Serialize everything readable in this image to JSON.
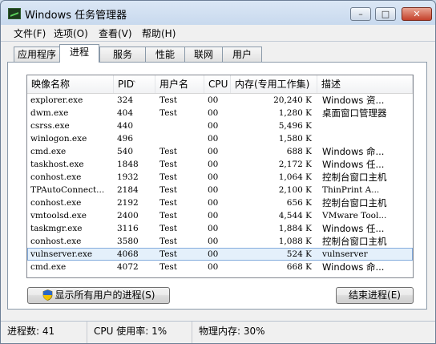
{
  "window": {
    "title": "Windows 任务管理器"
  },
  "window_buttons": {
    "minimize": "–",
    "maximize": "□",
    "close": "✕"
  },
  "menu": [
    "文件(F)",
    "选项(O)",
    "查看(V)",
    "帮助(H)"
  ],
  "tabs": [
    {
      "label": "应用程序",
      "active": false
    },
    {
      "label": "进程",
      "active": true
    },
    {
      "label": "服务",
      "active": false
    },
    {
      "label": "性能",
      "active": false
    },
    {
      "label": "联网",
      "active": false
    },
    {
      "label": "用户",
      "active": false
    }
  ],
  "columns": [
    "映像名称",
    "PID",
    "用户名",
    "CPU",
    "内存(专用工作集)",
    "描述"
  ],
  "sort": {
    "column": "PID",
    "indicator": "^"
  },
  "processes": [
    {
      "name": "explorer.exe",
      "pid": "324",
      "user": "Test",
      "cpu": "00",
      "mem": "20,240 K",
      "desc": "Windows 资..."
    },
    {
      "name": "dwm.exe",
      "pid": "404",
      "user": "Test",
      "cpu": "00",
      "mem": "1,280 K",
      "desc": "桌面窗口管理器"
    },
    {
      "name": "csrss.exe",
      "pid": "440",
      "user": "",
      "cpu": "00",
      "mem": "5,496 K",
      "desc": ""
    },
    {
      "name": "winlogon.exe",
      "pid": "496",
      "user": "",
      "cpu": "00",
      "mem": "1,580 K",
      "desc": ""
    },
    {
      "name": "cmd.exe",
      "pid": "540",
      "user": "Test",
      "cpu": "00",
      "mem": "688 K",
      "desc": "Windows 命..."
    },
    {
      "name": "taskhost.exe",
      "pid": "1848",
      "user": "Test",
      "cpu": "00",
      "mem": "2,172 K",
      "desc": "Windows 任..."
    },
    {
      "name": "conhost.exe",
      "pid": "1932",
      "user": "Test",
      "cpu": "00",
      "mem": "1,064 K",
      "desc": "控制台窗口主机"
    },
    {
      "name": "TPAutoConnect...",
      "pid": "2184",
      "user": "Test",
      "cpu": "00",
      "mem": "2,100 K",
      "desc": "ThinPrint A..."
    },
    {
      "name": "conhost.exe",
      "pid": "2192",
      "user": "Test",
      "cpu": "00",
      "mem": "656 K",
      "desc": "控制台窗口主机"
    },
    {
      "name": "vmtoolsd.exe",
      "pid": "2400",
      "user": "Test",
      "cpu": "00",
      "mem": "4,544 K",
      "desc": "VMware Tool..."
    },
    {
      "name": "taskmgr.exe",
      "pid": "3116",
      "user": "Test",
      "cpu": "00",
      "mem": "1,884 K",
      "desc": "Windows 任..."
    },
    {
      "name": "conhost.exe",
      "pid": "3580",
      "user": "Test",
      "cpu": "00",
      "mem": "1,088 K",
      "desc": "控制台窗口主机"
    },
    {
      "name": "vulnserver.exe",
      "pid": "4068",
      "user": "Test",
      "cpu": "00",
      "mem": "524 K",
      "desc": "vulnserver",
      "selected": true
    },
    {
      "name": "cmd.exe",
      "pid": "4072",
      "user": "Test",
      "cpu": "00",
      "mem": "668 K",
      "desc": "Windows 命..."
    }
  ],
  "buttons": {
    "show_all": "显示所有用户的进程(S)",
    "end_process": "结束进程(E)"
  },
  "status": {
    "processes": "进程数: 41",
    "cpu": "CPU 使用率: 1%",
    "memory": "物理内存: 30%"
  }
}
